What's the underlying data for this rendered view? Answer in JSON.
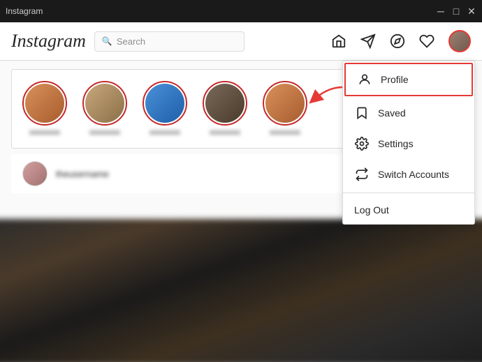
{
  "titleBar": {
    "title": "Instagram",
    "minimizeLabel": "─",
    "maximizeLabel": "□",
    "closeLabel": "✕"
  },
  "nav": {
    "logo": "Instagram",
    "search": {
      "placeholder": "Search",
      "iconLabel": "🔍"
    },
    "icons": {
      "home": "home-icon",
      "explore": "explore-icon",
      "compass": "compass-icon",
      "heart": "heart-icon",
      "profile": "profile-avatar-icon"
    }
  },
  "dropdown": {
    "items": [
      {
        "id": "profile",
        "label": "Profile",
        "icon": "person-icon",
        "highlighted": true
      },
      {
        "id": "saved",
        "label": "Saved",
        "icon": "bookmark-icon",
        "highlighted": false
      },
      {
        "id": "settings",
        "label": "Settings",
        "icon": "settings-icon",
        "highlighted": false
      },
      {
        "id": "switch-accounts",
        "label": "Switch Accounts",
        "icon": "switch-icon",
        "highlighted": false
      }
    ],
    "logoutLabel": "Log Out"
  },
  "stories": [
    {
      "username": "xxxxxxxx",
      "colorClass": "warm"
    },
    {
      "username": "xxxxxxxx",
      "colorClass": ""
    },
    {
      "username": "xxxxxxxx",
      "colorClass": "blue"
    },
    {
      "username": "xxxxxxxx",
      "colorClass": "dark"
    },
    {
      "username": "xxxxxxxx",
      "colorClass": "warm"
    }
  ],
  "profileSection": {
    "username": "theusername"
  }
}
